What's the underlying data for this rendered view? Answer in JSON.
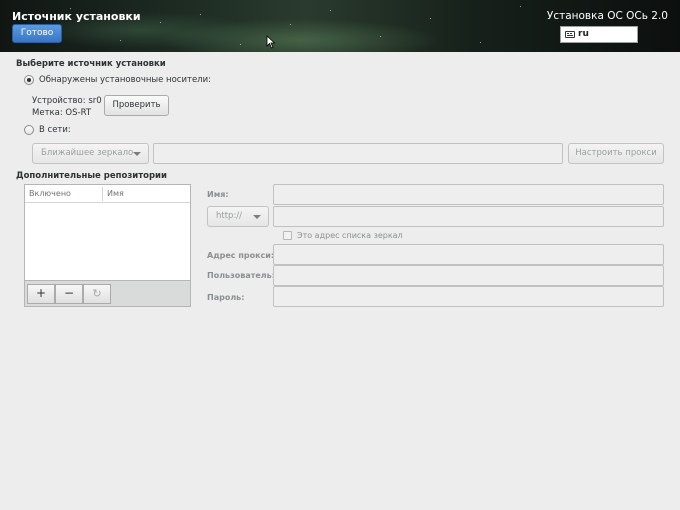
{
  "header": {
    "title": "Источник установки",
    "done_label": "Готово",
    "product": "Установка ОС ОСь 2.0",
    "keyboard_layout": "ru"
  },
  "source": {
    "section_title": "Выберите источник установки",
    "media_option_label": "Обнаружены установочные носители:",
    "device_label": "Устройство: sr0",
    "volume_label": "Метка: OS-RT",
    "verify_label": "Проверить",
    "network_option_label": "В сети:",
    "network_protocol": "Ближайшее зеркало",
    "proxy_button_label": "Настроить прокси"
  },
  "repos": {
    "section_title": "Дополнительные репозитории",
    "columns": [
      "Включено",
      "Имя"
    ],
    "add_label": "+",
    "remove_label": "−",
    "refresh_label": "↻",
    "name_label": "Имя:",
    "protocol": "http://",
    "mirrorlist_label": "Это адрес списка зеркал",
    "proxy_label": "Адрес прокси:",
    "user_label": "Пользователь:",
    "password_label": "Пароль:"
  }
}
